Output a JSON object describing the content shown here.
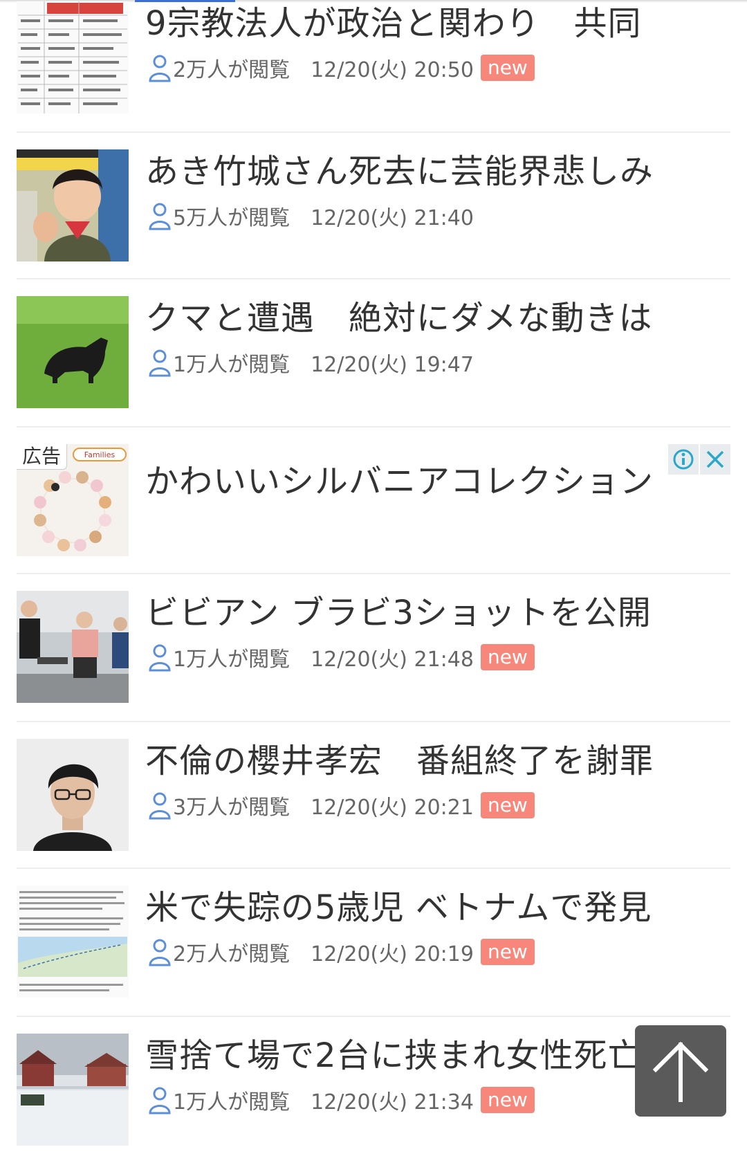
{
  "articles": [
    {
      "title": "9宗教法人が政治と関わり　共同",
      "views": "2万人が閲覧",
      "time": "12/20(火) 20:50",
      "badge": "new"
    },
    {
      "title": "あき竹城さん死去に芸能界悲しみ",
      "views": "5万人が閲覧",
      "time": "12/20(火) 21:40",
      "badge": ""
    },
    {
      "title": "クマと遭遇　絶対にダメな動きは",
      "views": "1万人が閲覧",
      "time": "12/20(火) 19:47",
      "badge": ""
    },
    {
      "title": "ビビアン ブラビ3ショットを公開",
      "views": "1万人が閲覧",
      "time": "12/20(火) 21:48",
      "badge": "new"
    },
    {
      "title": "不倫の櫻井孝宏　番組終了を謝罪",
      "views": "3万人が閲覧",
      "time": "12/20(火) 20:21",
      "badge": "new"
    },
    {
      "title": "米で失踪の5歳児 ベトナムで発見",
      "views": "2万人が閲覧",
      "time": "12/20(火) 20:19",
      "badge": "new"
    },
    {
      "title": "雪捨て場で2台に挟まれ女性死亡",
      "views": "1万人が閲覧",
      "time": "12/20(火) 21:34",
      "badge": "new"
    }
  ],
  "ad": {
    "label": "広告",
    "title": "かわいいシルバニアコレクション",
    "thumb_text": "Families"
  },
  "icons": {
    "views": "person-icon",
    "ad_info": "info-icon",
    "ad_close": "close-icon",
    "scroll_top": "arrow-up-icon"
  },
  "colors": {
    "new_badge": "#f6877a",
    "icon_blue": "#5b8fd9",
    "ad_icon": "#2aa7c9"
  }
}
